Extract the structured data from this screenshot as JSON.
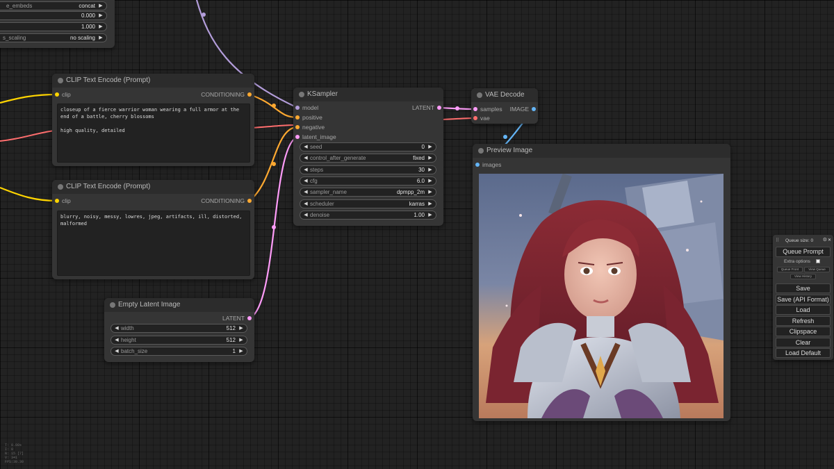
{
  "colors": {
    "clip": "#ffd500",
    "conditioning": "#ffa931",
    "latent": "#ff9cf9",
    "vae": "#ff6e6e",
    "image": "#64b5f6",
    "model": "#b39ddb"
  },
  "top_node": {
    "widgets": [
      {
        "name": "e_embeds",
        "value": "concat"
      },
      {
        "name": "",
        "value": "0.000"
      },
      {
        "name": "",
        "value": "1.000"
      },
      {
        "name": "s_scaling",
        "value": "no scaling"
      }
    ]
  },
  "clip_pos": {
    "title": "CLIP Text Encode (Prompt)",
    "input": "clip",
    "output": "CONDITIONING",
    "text": "closeup of a fierce warrior woman wearing a full armor at the end of a battle, cherry blossoms\n\nhigh quality, detailed"
  },
  "clip_neg": {
    "title": "CLIP Text Encode (Prompt)",
    "input": "clip",
    "output": "CONDITIONING",
    "text": "blurry, noisy, messy, lowres, jpeg, artifacts, ill, distorted, malformed"
  },
  "empty_latent": {
    "title": "Empty Latent Image",
    "output": "LATENT",
    "widgets": [
      {
        "name": "width",
        "value": "512"
      },
      {
        "name": "height",
        "value": "512"
      },
      {
        "name": "batch_size",
        "value": "1"
      }
    ]
  },
  "ksampler": {
    "title": "KSampler",
    "inputs": [
      "model",
      "positive",
      "negative",
      "latent_image"
    ],
    "output": "LATENT",
    "widgets": [
      {
        "name": "seed",
        "value": "0"
      },
      {
        "name": "control_after_generate",
        "value": "fixed"
      },
      {
        "name": "steps",
        "value": "30"
      },
      {
        "name": "cfg",
        "value": "6.0"
      },
      {
        "name": "sampler_name",
        "value": "dpmpp_2m"
      },
      {
        "name": "scheduler",
        "value": "karras"
      },
      {
        "name": "denoise",
        "value": "1.00"
      }
    ]
  },
  "vae_decode": {
    "title": "VAE Decode",
    "inputs": [
      "samples",
      "vae"
    ],
    "output": "IMAGE"
  },
  "preview": {
    "title": "Preview Image",
    "input": "images"
  },
  "menu": {
    "queue_size": "Queue size: 0",
    "queue_prompt": "Queue Prompt",
    "extra_options": "Extra options",
    "queue_front": "Queue Front",
    "view_queue": "View Queue",
    "view_history": "View History",
    "save": "Save",
    "save_api": "Save (API Format)",
    "load": "Load",
    "refresh": "Refresh",
    "clipspace": "Clipspace",
    "clear": "Clear",
    "load_default": "Load Default"
  },
  "stats": [
    "T: 0.00s",
    "I: 0",
    "N: 15 [7]",
    "V: 341",
    "FPS:30.30"
  ],
  "arrows": {
    "left": "◀",
    "right": "▶"
  },
  "icons": {
    "gear": "⚙",
    "close": "✕",
    "drag": "⠿"
  }
}
